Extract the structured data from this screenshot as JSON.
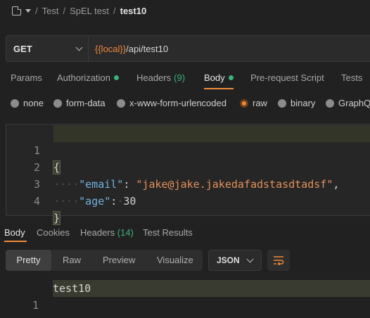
{
  "breadcrumb": {
    "items": [
      "Test",
      "SpEL test"
    ],
    "current": "test10"
  },
  "request": {
    "method": "GET",
    "url_variable": "{{local}}",
    "url_path": "/api/test10"
  },
  "request_tabs": [
    {
      "label": "Params"
    },
    {
      "label": "Authorization",
      "dot": true
    },
    {
      "label": "Headers",
      "count": "(9)"
    },
    {
      "label": "Body",
      "dot": true,
      "active": true
    },
    {
      "label": "Pre-request Script"
    },
    {
      "label": "Tests"
    }
  ],
  "body_types": [
    {
      "label": "none"
    },
    {
      "label": "form-data"
    },
    {
      "label": "x-www-form-urlencoded"
    },
    {
      "label": "raw",
      "selected": true
    },
    {
      "label": "binary"
    },
    {
      "label": "GraphQL"
    }
  ],
  "editor": {
    "line_numbers": [
      "1",
      "2",
      "3",
      "4"
    ],
    "open_brace": "{",
    "close_brace": "}",
    "key1": "\"email\"",
    "val1": "\"jake@jake.jakedafadstasdtadsf\"",
    "key2": "\"age\"",
    "val2": "30"
  },
  "response_tabs": [
    {
      "label": "Body",
      "active": true
    },
    {
      "label": "Cookies"
    },
    {
      "label": "Headers",
      "count": "(14)"
    },
    {
      "label": "Test Results"
    }
  ],
  "view_modes": [
    "Pretty",
    "Raw",
    "Preview",
    "Visualize"
  ],
  "format": "JSON",
  "response": {
    "line_number": "1",
    "text": "test10"
  },
  "colors": {
    "accent": "#f08a3a",
    "status_green": "#3bb37a",
    "json_key": "#73b3e0",
    "json_string": "#e4915a"
  },
  "icons": [
    "collection-icon",
    "chevron-down-icon",
    "wrap-lines-icon"
  ]
}
